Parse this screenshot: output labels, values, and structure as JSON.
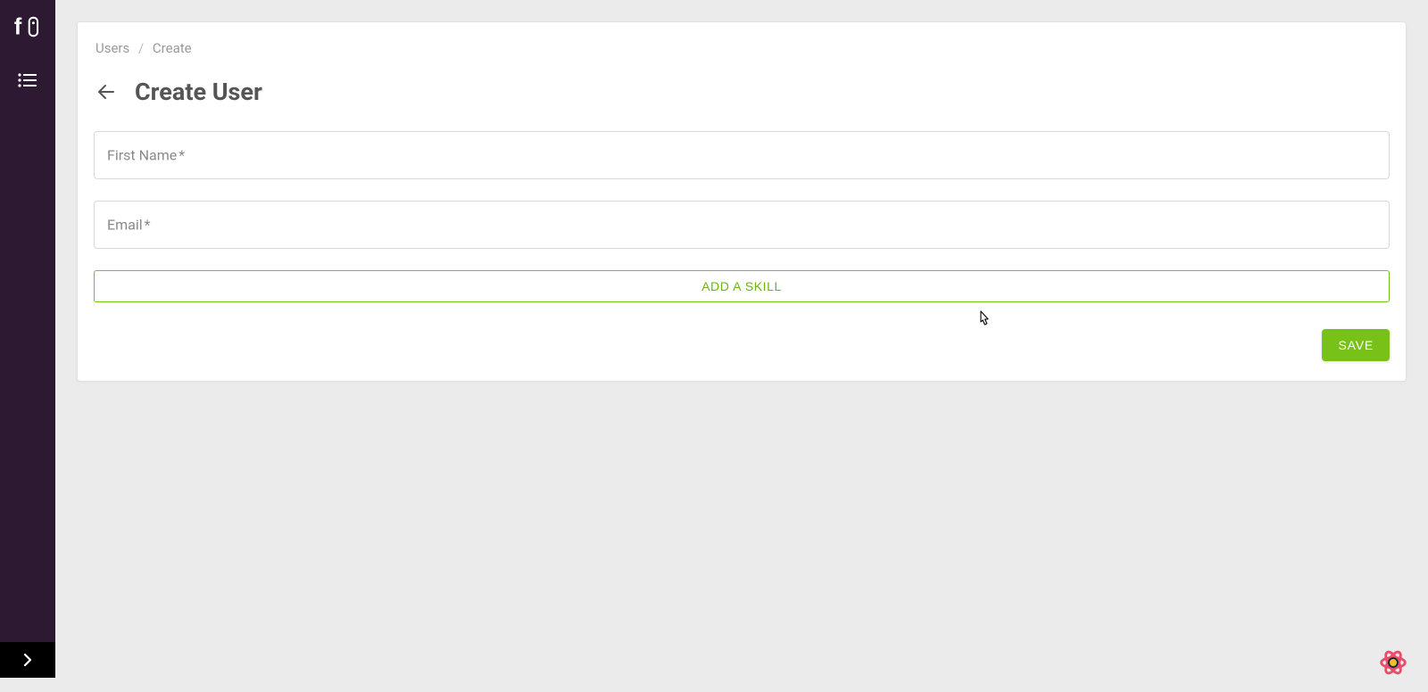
{
  "breadcrumb": {
    "root": "Users",
    "current": "Create"
  },
  "header": {
    "title": "Create User"
  },
  "form": {
    "first_name_label": "First Name",
    "first_name_value": "",
    "email_label": "Email",
    "email_value": "",
    "required_mark": "*"
  },
  "buttons": {
    "add_skill": "ADD A SKILL",
    "save": "SAVE"
  }
}
